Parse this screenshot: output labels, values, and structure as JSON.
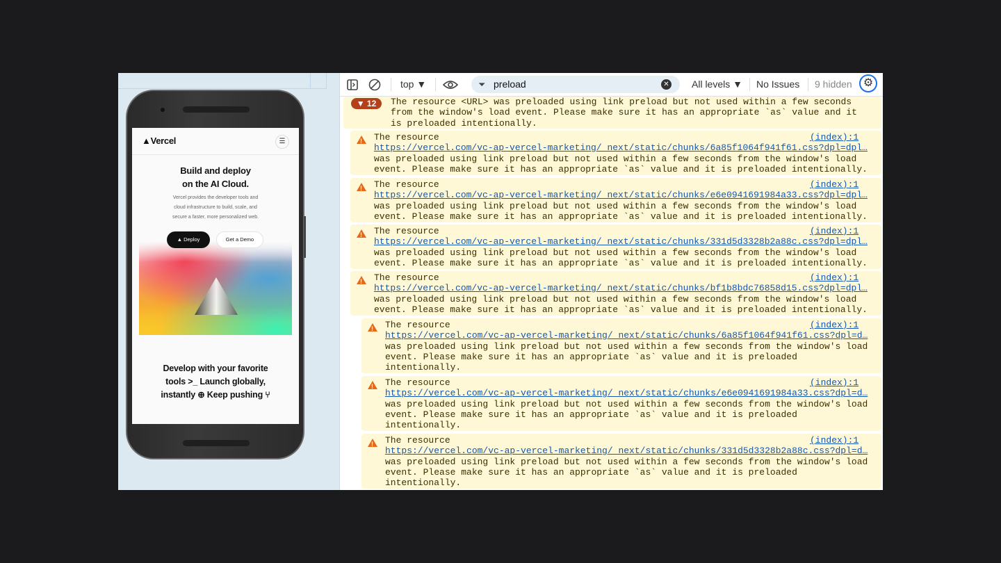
{
  "preview": {
    "logo": "▲Vercel",
    "menu_icon": "hamburger-icon",
    "hero_title_1": "Build and deploy",
    "hero_title_2": "on the AI Cloud.",
    "hero_sub_1": "Vercel provides the developer tools and",
    "hero_sub_2": "cloud infrastructure to build, scale, and",
    "hero_sub_3": "secure a faster, more personalized web.",
    "deploy_label": "▲  Deploy",
    "demo_label": "Get a Demo",
    "tagline_1": "Develop with your favorite",
    "tagline_2": "tools >_ Launch globally,",
    "tagline_3": "instantly ⊕ Keep pushing ⑂"
  },
  "toolbar": {
    "context": "top ▼",
    "filter_value": "preload",
    "levels": "All levels ▼",
    "issues": "No Issues",
    "hidden": "9 hidden",
    "accent": "#1a73e8"
  },
  "console": {
    "group": {
      "badge": "▼ 12",
      "line1": "The resource <URL> was preloaded using link preload but not used within a few seconds",
      "line2": "from the window's load event. Please make sure it has an appropriate `as` value and it",
      "line3": "is preloaded intentionally."
    },
    "messages": [
      {
        "line1": "The resource",
        "source": "(index):1",
        "url": "https://vercel.com/vc-ap-vercel-marketing/_next/static/chunks/6a85f1064f941f61.css?dpl=dpl…",
        "line3": "was preloaded using link preload but not used within a few seconds from the window's load",
        "line4": "event. Please make sure it has an appropriate `as` value and it is preloaded intentionally."
      },
      {
        "line1": "The resource",
        "source": "(index):1",
        "url": "https://vercel.com/vc-ap-vercel-marketing/_next/static/chunks/e6e0941691984a33.css?dpl=dpl…",
        "line3": "was preloaded using link preload but not used within a few seconds from the window's load",
        "line4": "event. Please make sure it has an appropriate `as` value and it is preloaded intentionally."
      },
      {
        "line1": "The resource",
        "source": "(index):1",
        "url": "https://vercel.com/vc-ap-vercel-marketing/_next/static/chunks/331d5d3328b2a88c.css?dpl=dpl…",
        "line3": "was preloaded using link preload but not used within a few seconds from the window's load",
        "line4": "event. Please make sure it has an appropriate `as` value and it is preloaded intentionally."
      },
      {
        "line1": "The resource",
        "source": "(index):1",
        "url": "https://vercel.com/vc-ap-vercel-marketing/_next/static/chunks/bf1b8bdc76858d15.css?dpl=dpl…",
        "line3": "was preloaded using link preload but not used within a few seconds from the window's load",
        "line4": "event. Please make sure it has an appropriate `as` value and it is preloaded intentionally."
      },
      {
        "line1": "The resource",
        "source": "(index):1",
        "url": "https://vercel.com/vc-ap-vercel-marketing/_next/static/chunks/6a85f1064f941f61.css?dpl=d…",
        "line3": "was preloaded using link preload but not used within a few seconds from the window's load",
        "line4": "event. Please make sure it has an appropriate `as` value and it is preloaded",
        "line5": "intentionally."
      },
      {
        "line1": "The resource",
        "source": "(index):1",
        "url": "https://vercel.com/vc-ap-vercel-marketing/_next/static/chunks/e6e0941691984a33.css?dpl=d…",
        "line3": "was preloaded using link preload but not used within a few seconds from the window's load",
        "line4": "event. Please make sure it has an appropriate `as` value and it is preloaded",
        "line5": "intentionally."
      },
      {
        "line1": "The resource",
        "source": "(index):1",
        "url": "https://vercel.com/vc-ap-vercel-marketing/_next/static/chunks/331d5d3328b2a88c.css?dpl=d…",
        "line3": "was preloaded using link preload but not used within a few seconds from the window's load",
        "line4": "event. Please make sure it has an appropriate `as` value and it is preloaded",
        "line5": "intentionally."
      }
    ],
    "warning_color": "#e46a1a",
    "warning_bg": "#fff8d6"
  }
}
